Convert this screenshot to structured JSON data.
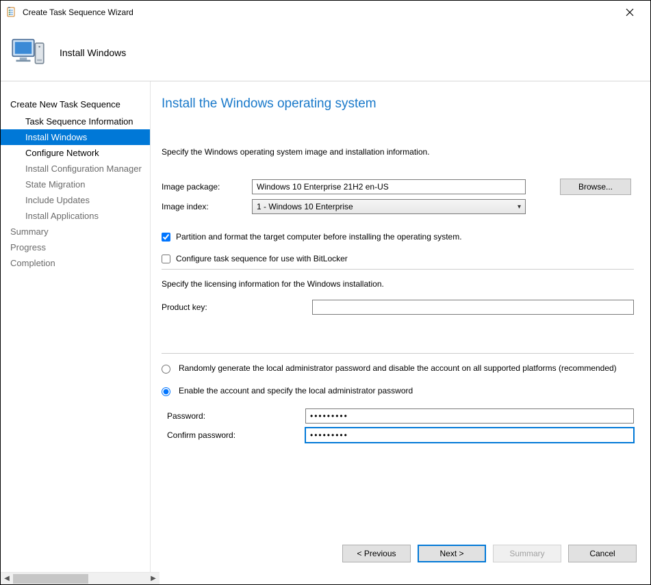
{
  "titlebar": {
    "title": "Create Task Sequence Wizard"
  },
  "header": {
    "title": "Install Windows"
  },
  "sidebar": {
    "root": "Create New Task Sequence",
    "items": [
      {
        "label": "Task Sequence Information",
        "state": "normal"
      },
      {
        "label": "Install Windows",
        "state": "active"
      },
      {
        "label": "Configure Network",
        "state": "normal"
      },
      {
        "label": "Install Configuration Manager",
        "state": "disabled"
      },
      {
        "label": "State Migration",
        "state": "disabled"
      },
      {
        "label": "Include Updates",
        "state": "disabled"
      },
      {
        "label": "Install Applications",
        "state": "disabled"
      }
    ],
    "trailing": [
      {
        "label": "Summary",
        "state": "disabled"
      },
      {
        "label": "Progress",
        "state": "disabled"
      },
      {
        "label": "Completion",
        "state": "disabled"
      }
    ]
  },
  "main": {
    "heading": "Install the Windows operating system",
    "instruction1": "Specify the Windows operating system image and installation information.",
    "image_package_label": "Image package:",
    "image_package_value": "Windows 10 Enterprise 21H2 en-US",
    "browse_label": "Browse...",
    "image_index_label": "Image index:",
    "image_index_value": "1 - Windows 10 Enterprise",
    "partition_checkbox": "Partition and format the target computer before installing the operating system.",
    "bitlocker_checkbox": "Configure task sequence for use with BitLocker",
    "licensing_instruction": "Specify the licensing information for the Windows installation.",
    "product_key_label": "Product key:",
    "product_key_value": "",
    "radio_random": "Randomly generate the local administrator password and disable the account on all supported platforms (recommended)",
    "radio_enable": "Enable the account and specify the local administrator password",
    "password_label": "Password:",
    "confirm_password_label": "Confirm password:",
    "password_value": "•••••••••",
    "confirm_password_value": "•••••••••"
  },
  "buttons": {
    "previous": "< Previous",
    "next": "Next >",
    "summary": "Summary",
    "cancel": "Cancel"
  }
}
